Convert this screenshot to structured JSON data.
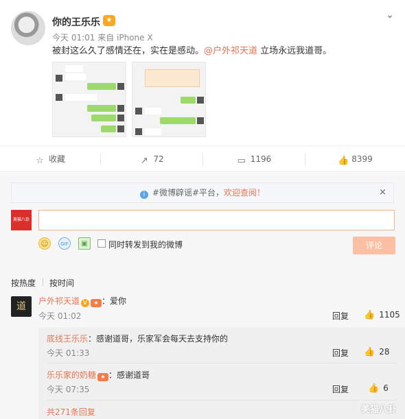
{
  "post": {
    "author": "你的王乐乐",
    "meta": "今天 01:01 来自 iPhone X",
    "text_before": "被封这么久了感情还在，实在是感动。",
    "mention": "@户外祁天道",
    "text_after": " 立场永远我道哥。"
  },
  "actions": {
    "favorite": "收藏",
    "forward": "72",
    "comment": "1196",
    "like": "8399"
  },
  "notice": {
    "prefix": "#微博辟谣#平台，",
    "link": "欢迎查阅！",
    "close": "×"
  },
  "composer": {
    "forward_label": "同时转发到我的微博",
    "submit": "评论"
  },
  "sort": {
    "hot": "按热度",
    "time": "按时间"
  },
  "comments": [
    {
      "user": "户外祁天道",
      "text": "：爱你",
      "time": "今天 01:02",
      "reply": "回复",
      "likes": "1105"
    }
  ],
  "replies": [
    {
      "user": "底线王乐乐",
      "text": "：感谢道哥，乐家军会每天去支持你的",
      "time": "今天 01:33",
      "reply": "回复",
      "likes": "28"
    },
    {
      "user": "乐乐家的奶糖",
      "text": "：感谢道哥",
      "time": "今天 07:35",
      "reply": "回复",
      "likes": "6"
    }
  ],
  "more_replies": "共271条回复",
  "watermark": "美猫八卦",
  "icons": {
    "favorite": "star-icon",
    "forward": "forward-icon",
    "comment": "comment-icon",
    "like": "thumbs-up-icon"
  },
  "colors": {
    "accent": "#eb7350",
    "input_border": "#f2b286",
    "submit_bg": "#fbbfa4"
  }
}
